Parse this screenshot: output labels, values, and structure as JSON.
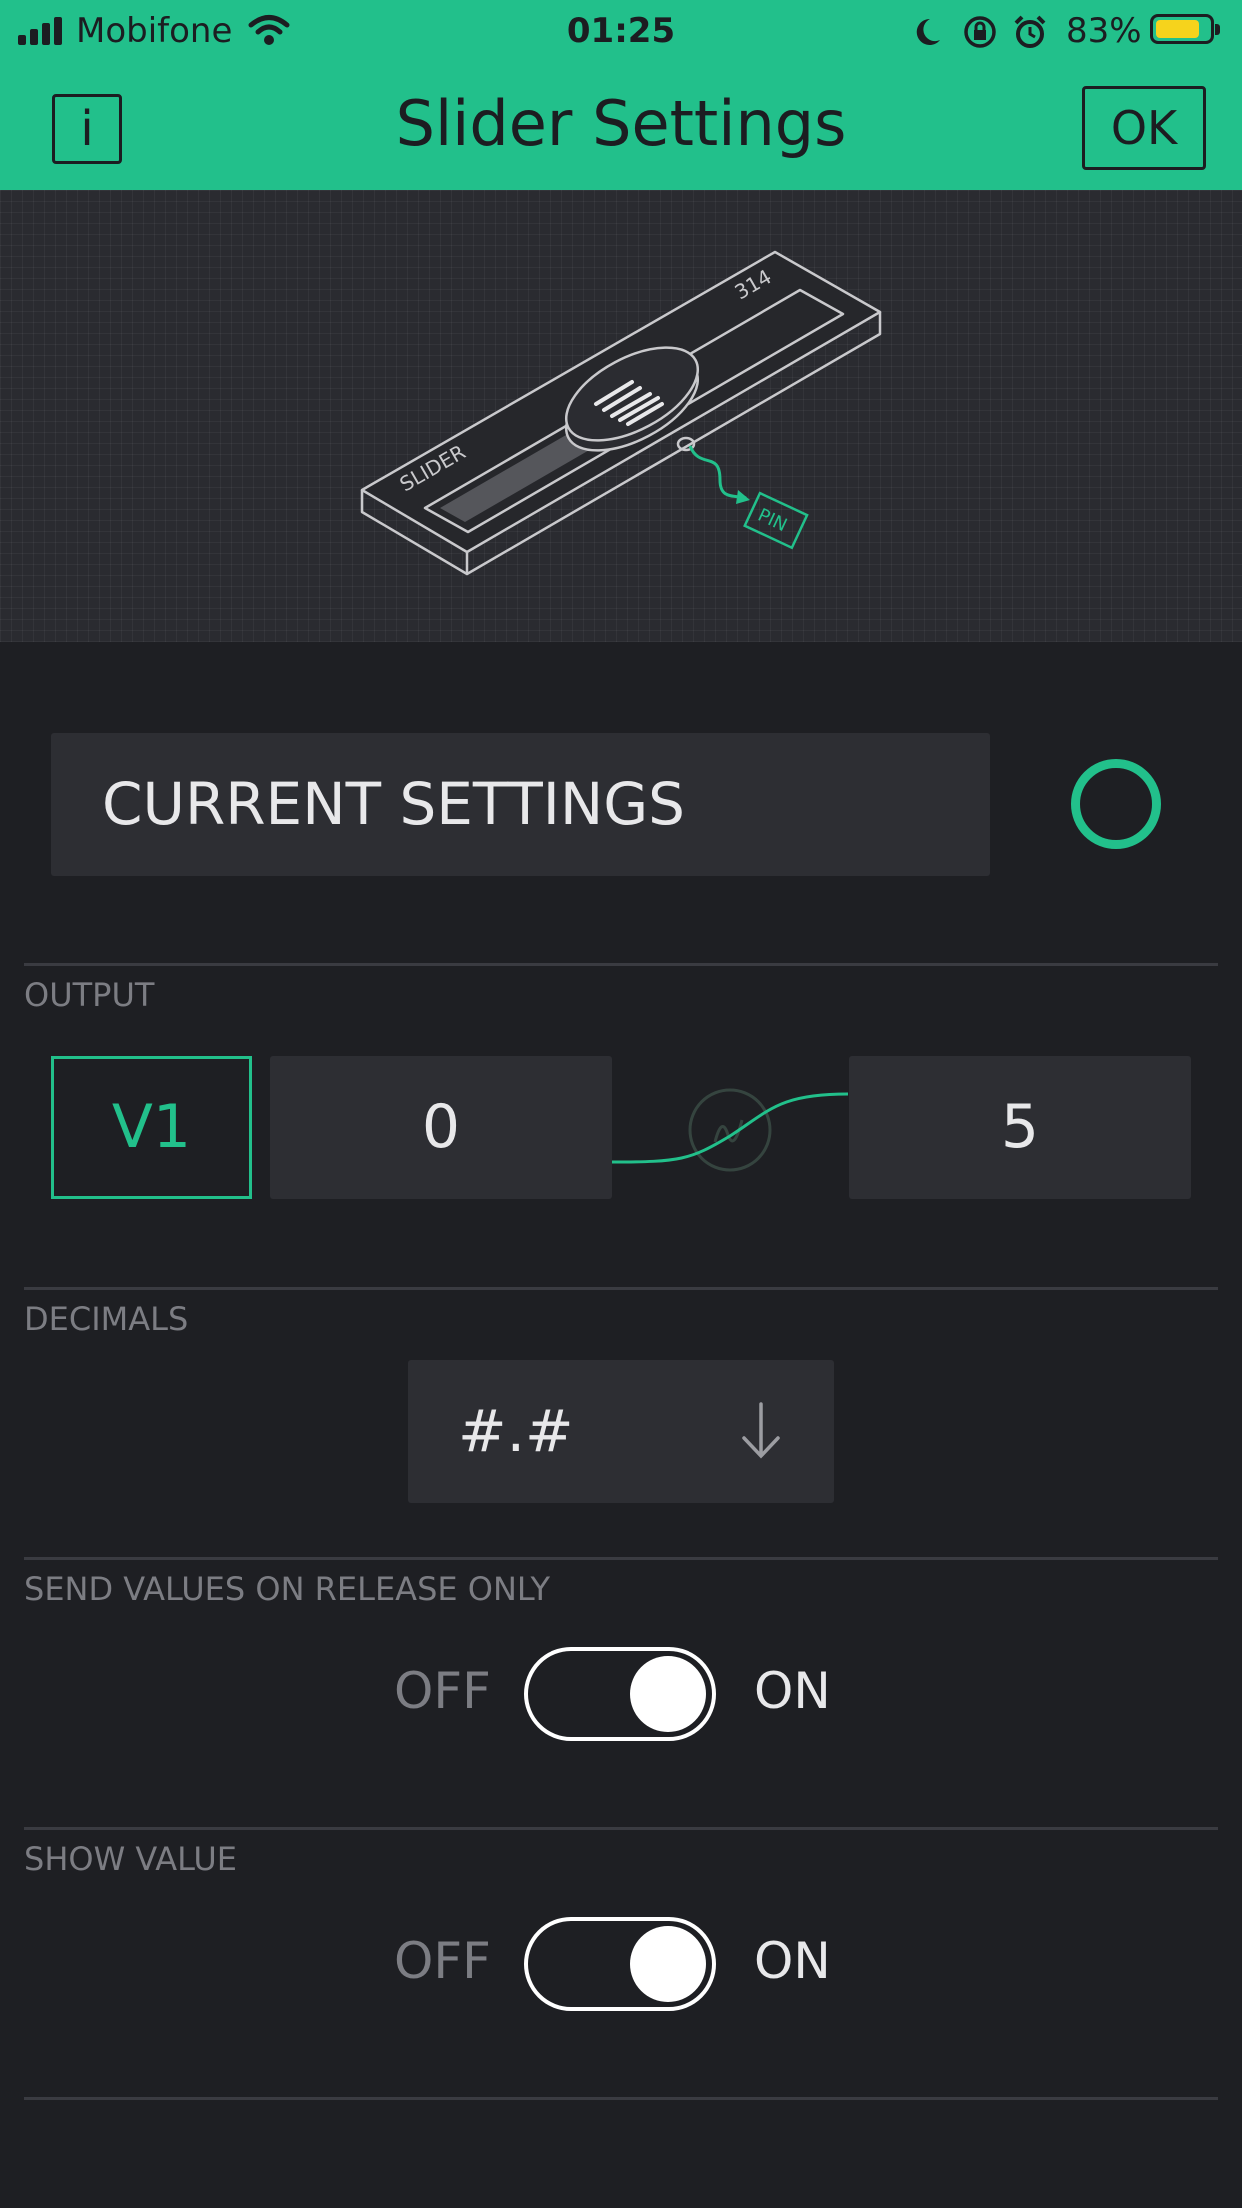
{
  "status_bar": {
    "carrier": "Mobifone",
    "time": "01:25",
    "battery_percent": "83%",
    "battery_level": 0.83,
    "icons": [
      "cellular-signal-icon",
      "wifi-icon",
      "moon-icon",
      "rotation-lock-icon",
      "alarm-icon",
      "battery-icon"
    ]
  },
  "header": {
    "title": "Slider Settings",
    "info_label": "i",
    "ok_label": "OK"
  },
  "preview": {
    "widget_label": "SLIDER",
    "value_label": "314",
    "pin_label": "PIN"
  },
  "current_settings": {
    "label": "CURRENT SETTINGS"
  },
  "output": {
    "label": "OUTPUT",
    "pin": "V1",
    "min": "0",
    "max": "5"
  },
  "decimals": {
    "label": "DECIMALS",
    "selected": "#.#"
  },
  "send_on_release": {
    "label": "SEND VALUES ON RELEASE ONLY",
    "off_label": "OFF",
    "on_label": "ON",
    "state": "on"
  },
  "show_value": {
    "label": "SHOW VALUE",
    "off_label": "OFF",
    "on_label": "ON",
    "state": "on"
  },
  "colors": {
    "accent": "#22c08b",
    "background": "#1e1f23",
    "field": "#2d2e33",
    "battery": "#f6d31c"
  }
}
